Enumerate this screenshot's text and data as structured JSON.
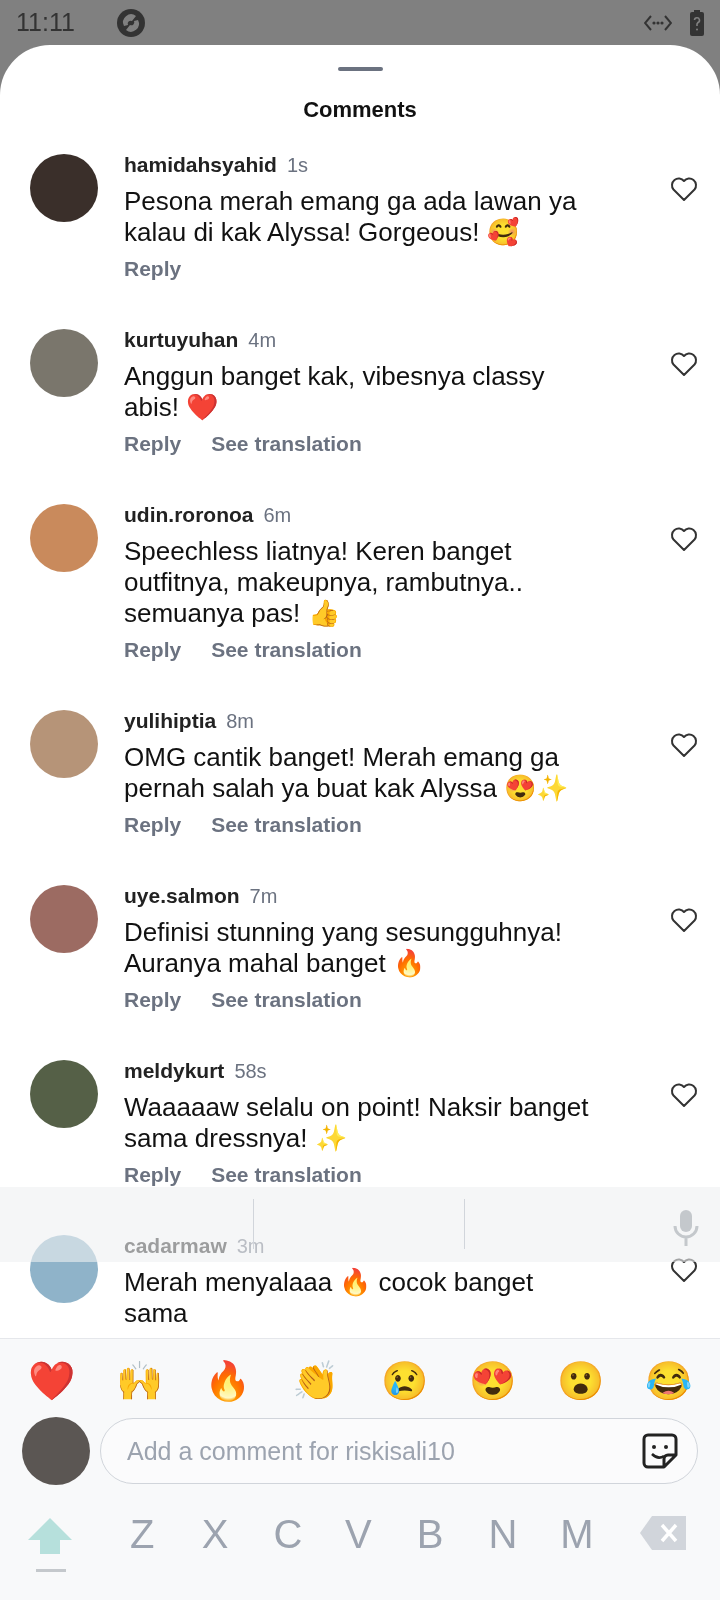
{
  "status_bar": {
    "time": "11:11"
  },
  "sheet": {
    "title": "Comments"
  },
  "comments": [
    {
      "username": "hamidahsyahid",
      "time": "1s",
      "text": "Pesona merah emang ga ada lawan ya kalau di kak Alyssa! Gorgeous! 🥰",
      "actions": [
        "Reply"
      ],
      "liked": false
    },
    {
      "username": "kurtuyuhan",
      "time": "4m",
      "text": "Anggun banget kak, vibesnya classy abis! ❤️",
      "actions": [
        "Reply",
        "See translation"
      ],
      "liked": false
    },
    {
      "username": "udin.roronoa",
      "time": "6m",
      "text": "Speechless liatnya! Keren banget outfitnya, makeupnya, rambutnya.. semuanya pas! 👍",
      "actions": [
        "Reply",
        "See translation"
      ],
      "liked": false
    },
    {
      "username": "yulihiptia",
      "time": "8m",
      "text": "OMG cantik banget! Merah emang ga pernah salah ya buat kak Alyssa 😍✨",
      "actions": [
        "Reply",
        "See translation"
      ],
      "liked": false
    },
    {
      "username": "uye.salmon",
      "time": "7m",
      "text": "Definisi stunning yang sesungguhnya! Auranya mahal banget 🔥",
      "actions": [
        "Reply",
        "See translation"
      ],
      "liked": false
    },
    {
      "username": "meldykurt",
      "time": "58s",
      "text": "Waaaaaw selalu on point! Naksir banget sama dressnya! ✨",
      "actions": [
        "Reply",
        "See translation"
      ],
      "liked": false
    },
    {
      "username": "cadarmaw",
      "time": "3m",
      "text": "Merah menyalaaa 🔥 cocok banget sama",
      "liked": false
    }
  ],
  "quick_reactions": [
    "❤️",
    "🙌",
    "🔥",
    "👏",
    "😢",
    "😍",
    "😮",
    "😂"
  ],
  "composer": {
    "placeholder": "Add a comment for riskisali10"
  },
  "keyboard": {
    "bottom_row": [
      "Z",
      "X",
      "C",
      "V",
      "B",
      "N",
      "M"
    ]
  }
}
